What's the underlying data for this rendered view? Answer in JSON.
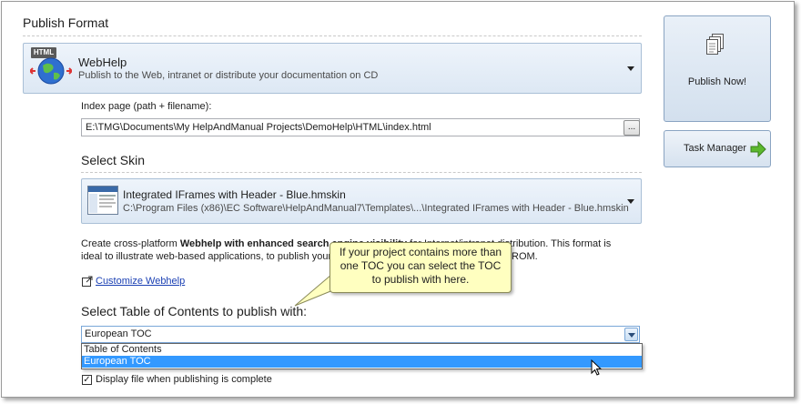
{
  "publish_format": {
    "section_title": "Publish Format",
    "format_badge": "HTML",
    "format_icon": "globe-icon",
    "format_name": "WebHelp",
    "format_description": "Publish to the Web, intranet or distribute your documentation on CD"
  },
  "index_page": {
    "label": "Index page (path + filename):",
    "value": "E:\\TMG\\Documents\\My HelpAndManual Projects\\DemoHelp\\HTML\\index.html",
    "browse_label": "..."
  },
  "skin": {
    "section_title": "Select Skin",
    "name": "Integrated IFrames with Header - Blue.hmskin",
    "path": "C:\\Program Files (x86)\\EC Software\\HelpAndManual7\\Templates\\...\\Integrated IFrames with Header - Blue.hmskin"
  },
  "description": {
    "line1_a": "Create cross-platform ",
    "line1_bold": "Webhelp with enhanced search engine visibility",
    "line1_b": " for Internet/intranet distribution. This format is",
    "line2_a": "ideal to illustrate web-based applications, to publish your",
    "line2_b": "ROM.",
    "customize_link": "Customize Webhelp"
  },
  "callout": {
    "text": "If your project contains more than one TOC you can select the TOC to publish with here."
  },
  "toc": {
    "section_title": "Select Table of Contents to publish with:",
    "selected": "European TOC",
    "options": [
      "Table of Contents",
      "European TOC"
    ]
  },
  "display_file": {
    "checked": true,
    "label": "Display file when publishing is complete"
  },
  "actions": {
    "publish_now": "Publish Now!",
    "task_manager": "Task Manager"
  },
  "colors": {
    "selection": "#3399ff",
    "link": "#1a3fb3",
    "callout_bg": "#ffffc0",
    "arrow_green": "#5cb82e"
  }
}
